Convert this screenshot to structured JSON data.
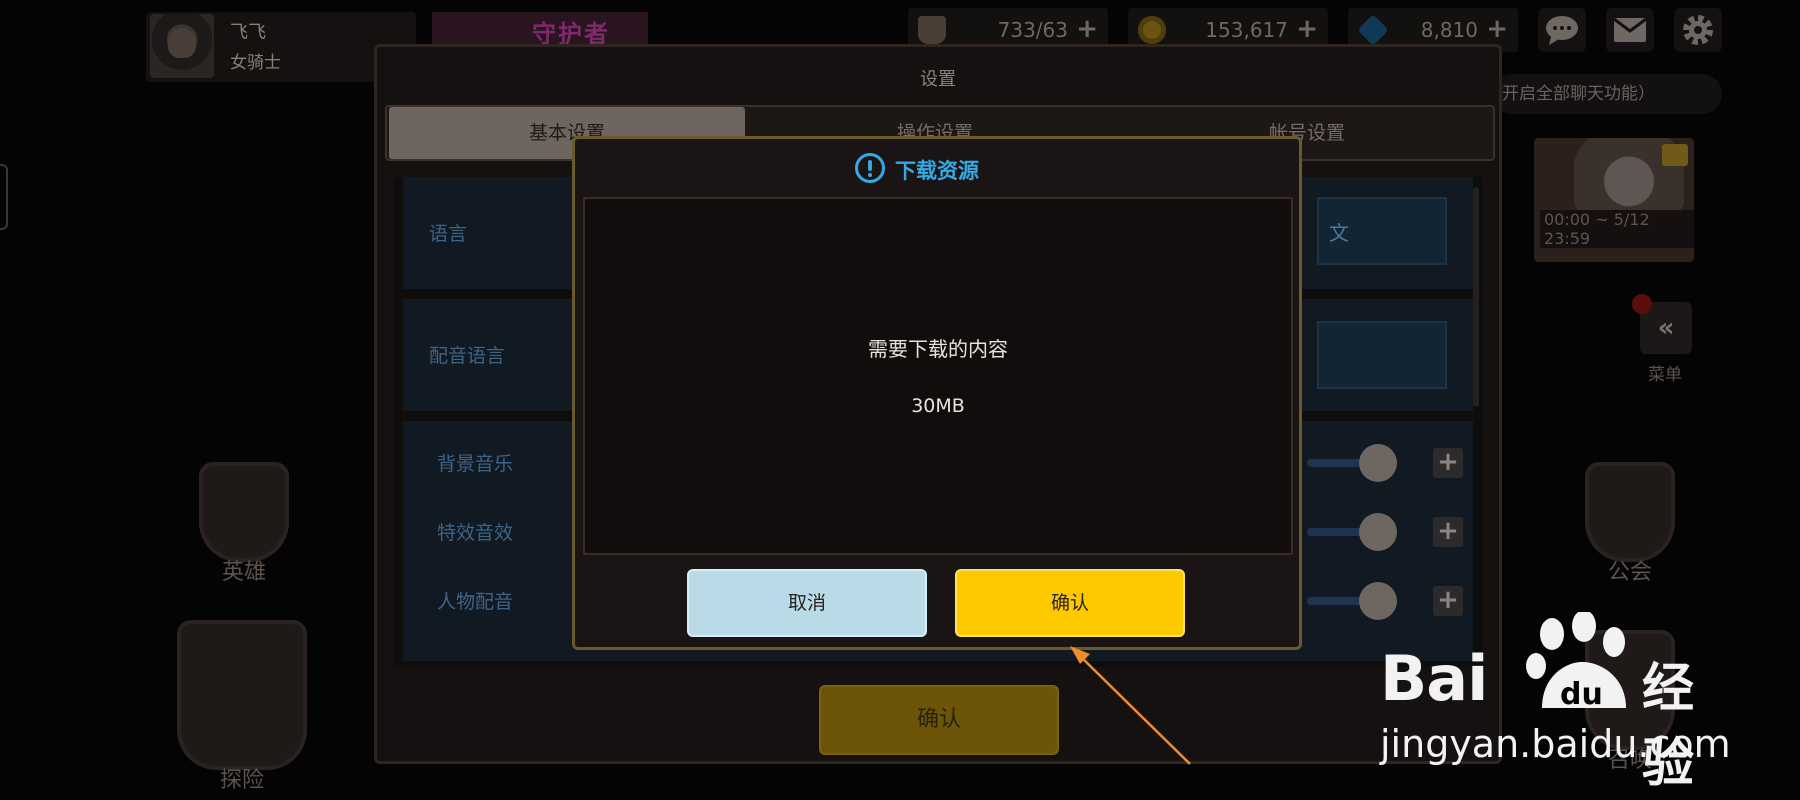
{
  "player": {
    "name": "飞飞",
    "class": "女骑士"
  },
  "event_banner": {
    "text": "守护者"
  },
  "resources": {
    "stamina": "733/63",
    "gold": "153,617",
    "gems": "8,810",
    "plus": "+"
  },
  "chat_bar": {
    "text": "开启全部聊天功能）"
  },
  "right_banner": {
    "time": "00:00 ~ 5/12 23:59"
  },
  "menu": {
    "label": "菜单",
    "icon": "«"
  },
  "side_nav": {
    "hero": "英雄",
    "explore": "探险",
    "guild": "公会",
    "summon": "召唤"
  },
  "settings": {
    "title": "设置",
    "tabs": {
      "basic": "基本设置",
      "ops": "操作设置",
      "account": "帐号设置"
    },
    "rows": {
      "language": "语言",
      "language_value": "文",
      "voice_language": "配音语言",
      "bgm": "背景音乐",
      "sfx": "特效音效",
      "character_voice": "人物配音"
    },
    "confirm": "确认"
  },
  "dialog": {
    "title": "下载资源",
    "message": "需要下载的内容",
    "size": "30MB",
    "cancel": "取消",
    "confirm": "确认"
  },
  "watermark": {
    "brand": "Bai",
    "du": "du",
    "jingyan": "经验",
    "url": "jingyan.baidu.com"
  },
  "colors": {
    "accent_blue": "#35a9e6",
    "confirm_yellow": "#fdca00",
    "cancel_blue": "#b9dbe8",
    "arrow": "#f28c28"
  }
}
